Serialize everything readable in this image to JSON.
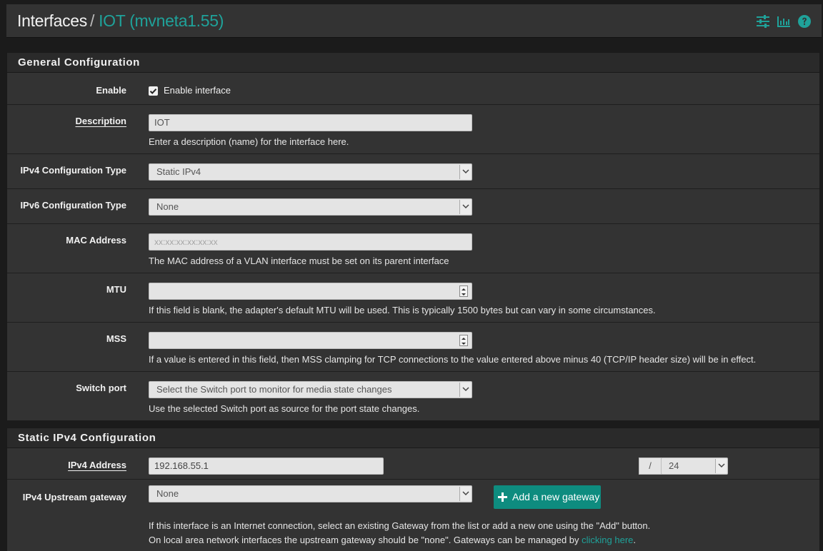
{
  "header": {
    "breadcrumb_root": "Interfaces",
    "separator": "/",
    "breadcrumb_current": "IOT (mvneta1.55)",
    "icons": [
      "sliders-icon",
      "bar-chart-icon",
      "help-icon"
    ],
    "accent_color": "#1fa29a"
  },
  "general": {
    "title": "General Configuration",
    "enable": {
      "label": "Enable",
      "checkbox_label": "Enable interface",
      "checked": true
    },
    "description": {
      "label": "Description",
      "value": "IOT",
      "help": "Enter a description (name) for the interface here."
    },
    "ipv4_type": {
      "label": "IPv4 Configuration Type",
      "value": "Static IPv4"
    },
    "ipv6_type": {
      "label": "IPv6 Configuration Type",
      "value": "None"
    },
    "mac": {
      "label": "MAC Address",
      "placeholder": "xx:xx:xx:xx:xx:xx",
      "help": "The MAC address of a VLAN interface must be set on its parent interface"
    },
    "mtu": {
      "label": "MTU",
      "value": "",
      "help": "If this field is blank, the adapter's default MTU will be used. This is typically 1500 bytes but can vary in some circumstances."
    },
    "mss": {
      "label": "MSS",
      "value": "",
      "help": "If a value is entered in this field, then MSS clamping for TCP connections to the value entered above minus 40 (TCP/IP header size) will be in effect."
    },
    "switch_port": {
      "label": "Switch port",
      "value": "Select the Switch port to monitor for media state changes",
      "help": "Use the selected Switch port as source for the port state changes."
    }
  },
  "static_ipv4": {
    "title": "Static IPv4 Configuration",
    "address": {
      "label": "IPv4 Address",
      "value": "192.168.55.1",
      "slash": "/",
      "cidr": "24"
    },
    "gateway": {
      "label": "IPv4 Upstream gateway",
      "value": "None",
      "add_button": "Add a new gateway",
      "help_line1": "If this interface is an Internet connection, select an existing Gateway from the list or add a new one using the \"Add\" button.",
      "help_line2_prefix": "On local area network interfaces the upstream gateway should be \"none\". Gateways can be managed by ",
      "help_link": "clicking here",
      "help_line2_suffix": "."
    }
  }
}
